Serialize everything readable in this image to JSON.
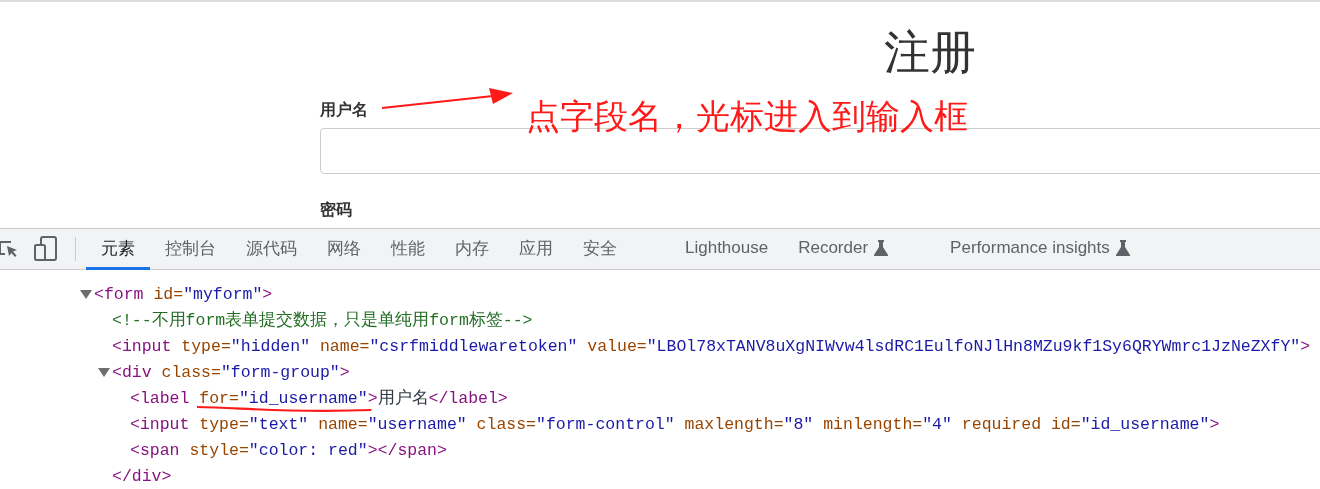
{
  "page": {
    "title": "注册",
    "fields": [
      {
        "label": "用户名",
        "kind": "text"
      },
      {
        "label": "密码",
        "kind": "label"
      }
    ],
    "annotation": {
      "text": "点字段名，光标进入到输入框"
    }
  },
  "devtools": {
    "tabs": [
      {
        "label": "元素",
        "selected": true,
        "experimental": false
      },
      {
        "label": "控制台",
        "selected": false,
        "experimental": false
      },
      {
        "label": "源代码",
        "selected": false,
        "experimental": false
      },
      {
        "label": "网络",
        "selected": false,
        "experimental": false
      },
      {
        "label": "性能",
        "selected": false,
        "experimental": false
      },
      {
        "label": "内存",
        "selected": false,
        "experimental": false
      },
      {
        "label": "应用",
        "selected": false,
        "experimental": false
      },
      {
        "label": "安全",
        "selected": false,
        "experimental": false
      },
      {
        "label": "Lighthouse",
        "selected": false,
        "experimental": false
      },
      {
        "label": "Recorder",
        "selected": false,
        "experimental": true
      },
      {
        "label": "Performance insights",
        "selected": false,
        "experimental": true
      }
    ],
    "elements_tree": [
      {
        "expanded": true,
        "parts": [
          {
            "kind": "tag",
            "text": "<form "
          },
          {
            "kind": "attr",
            "text": "id="
          },
          {
            "kind": "value",
            "text": "\"myform\""
          },
          {
            "kind": "tag",
            "text": ">"
          }
        ],
        "children": [
          {
            "parts": [
              {
                "kind": "comment",
                "text": "<!--不用form表单提交数据，只是单纯用form标签-->"
              }
            ]
          },
          {
            "parts": [
              {
                "kind": "tag",
                "text": "<input "
              },
              {
                "kind": "attr",
                "text": "type="
              },
              {
                "kind": "value",
                "text": "\"hidden\""
              },
              {
                "kind": "attr",
                "text": " name="
              },
              {
                "kind": "value",
                "text": "\"csrfmiddlewaretoken\""
              },
              {
                "kind": "attr",
                "text": " value="
              },
              {
                "kind": "value",
                "text": "\"LBOl78xTANV8uXgNIWvw4lsdRC1EulfoNJlHn8MZu9kf1Sy6QRYWmrc1JzNeZXfY\""
              },
              {
                "kind": "tag",
                "text": ">"
              }
            ]
          },
          {
            "expanded": true,
            "parts": [
              {
                "kind": "tag",
                "text": "<div "
              },
              {
                "kind": "attr",
                "text": "class="
              },
              {
                "kind": "value",
                "text": "\"form-group\""
              },
              {
                "kind": "tag",
                "text": ">"
              }
            ],
            "children": [
              {
                "parts": [
                  {
                    "kind": "tag",
                    "text": "<label "
                  },
                  {
                    "kind": "attr",
                    "text": "for=",
                    "underlined": true
                  },
                  {
                    "kind": "value",
                    "text": "\"id_username\"",
                    "underlined": true
                  },
                  {
                    "kind": "tag",
                    "text": ">"
                  },
                  {
                    "kind": "text",
                    "text": "用户名"
                  },
                  {
                    "kind": "tag",
                    "text": "</label>"
                  }
                ]
              },
              {
                "parts": [
                  {
                    "kind": "tag",
                    "text": "<input "
                  },
                  {
                    "kind": "attr",
                    "text": "type="
                  },
                  {
                    "kind": "value",
                    "text": "\"text\""
                  },
                  {
                    "kind": "attr",
                    "text": " name="
                  },
                  {
                    "kind": "value",
                    "text": "\"username\""
                  },
                  {
                    "kind": "attr",
                    "text": " class="
                  },
                  {
                    "kind": "value",
                    "text": "\"form-control\""
                  },
                  {
                    "kind": "attr",
                    "text": " maxlength="
                  },
                  {
                    "kind": "value",
                    "text": "\"8\""
                  },
                  {
                    "kind": "attr",
                    "text": " minlength="
                  },
                  {
                    "kind": "value",
                    "text": "\"4\""
                  },
                  {
                    "kind": "attr",
                    "text": " required id="
                  },
                  {
                    "kind": "value",
                    "text": "\"id_username\""
                  },
                  {
                    "kind": "tag",
                    "text": ">"
                  }
                ]
              },
              {
                "parts": [
                  {
                    "kind": "tag",
                    "text": "<span "
                  },
                  {
                    "kind": "attr",
                    "text": "style="
                  },
                  {
                    "kind": "value",
                    "text": "\"color: red\""
                  },
                  {
                    "kind": "tag",
                    "text": "></span>"
                  }
                ]
              }
            ]
          },
          {
            "parts": [
              {
                "kind": "tag",
                "text": "</div>"
              }
            ]
          }
        ]
      }
    ]
  }
}
